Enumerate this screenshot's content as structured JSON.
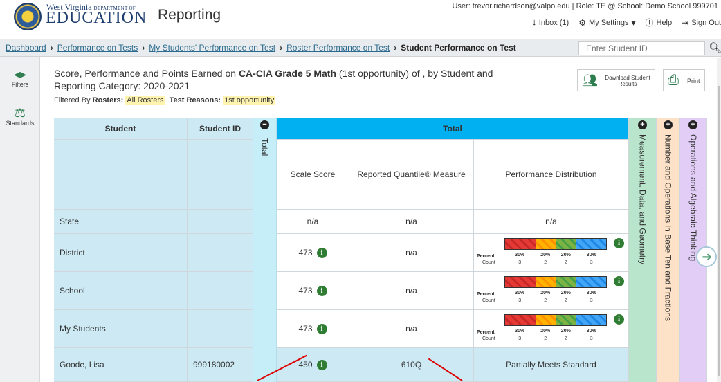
{
  "header": {
    "logo_top": "West Virginia",
    "logo_dept": "DEPARTMENT OF",
    "logo_main": "EDUCATION",
    "app_title": "Reporting",
    "user_line": "User: trevor.richardson@valpo.edu  |  Role: TE @ School: Demo School 999701",
    "inbox": "Inbox (1)",
    "settings": "My Settings",
    "help": "Help",
    "signout": "Sign Out"
  },
  "breadcrumb": {
    "items": [
      "Dashboard",
      "Performance on Tests",
      "My Students' Performance on Test",
      "Roster Performance on Test"
    ],
    "current": "Student Performance on Test",
    "search_placeholder": "Enter Student ID"
  },
  "sidebar": {
    "filters": "Filters",
    "standards": "Standards"
  },
  "title": {
    "prefix": "Score, Performance and Points Earned on ",
    "test": "CA-CIA Grade 5 Math",
    "suffix": " (1st opportunity) of , by Student and Reporting Category: 2020-2021",
    "filtered_label": "Filtered By ",
    "rosters_label": "Rosters:",
    "rosters_value": "All Rosters",
    "reasons_label": "Test Reasons:",
    "reasons_value": "1st opportunity"
  },
  "buttons": {
    "download": "Download Student Results",
    "print": "Print"
  },
  "table": {
    "col_student": "Student",
    "col_student_id": "Student ID",
    "col_total_vertical": "Total",
    "col_total": "Total",
    "sub_scale": "Scale Score",
    "sub_quantile": "Reported Quantile® Measure",
    "sub_perf": "Performance Distribution",
    "col_meas": "Measurement, Data, and Geometry",
    "col_num": "Number and Operations in Base Ten and Fractions",
    "col_ops": "Operations and Algebraic Thinking",
    "rows": [
      {
        "student": "State",
        "id": "",
        "scale": "n/a",
        "quantile": "n/a",
        "perf": "n/a"
      },
      {
        "student": "District",
        "id": "",
        "scale": "473",
        "quantile": "n/a",
        "perf": ""
      },
      {
        "student": "School",
        "id": "",
        "scale": "473",
        "quantile": "n/a",
        "perf": ""
      },
      {
        "student": "My Students",
        "id": "",
        "scale": "473",
        "quantile": "n/a",
        "perf": ""
      },
      {
        "student": "Goode, Lisa",
        "id": "999180002",
        "scale": "450",
        "quantile": "610Q",
        "perf": "Partially Meets Standard"
      }
    ],
    "dist": {
      "percent_label": "Percent",
      "count_label": "Count",
      "percents": [
        "30%",
        "20%",
        "20%",
        "30%"
      ],
      "counts": [
        "3",
        "2",
        "2",
        "3"
      ],
      "shares": [
        0.3,
        0.2,
        0.2,
        0.3
      ]
    }
  }
}
